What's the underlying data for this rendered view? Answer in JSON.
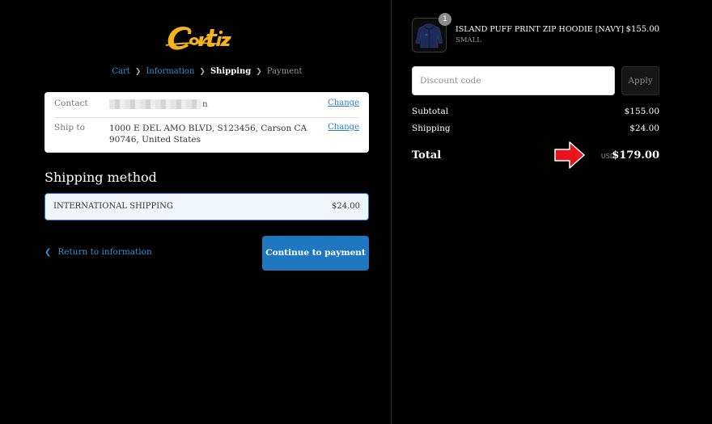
{
  "brand": {
    "logo_text": "Cortiz",
    "logo_color": "#f2b418"
  },
  "breadcrumb": [
    {
      "label": "Cart",
      "state": "link"
    },
    {
      "label": "Information",
      "state": "link"
    },
    {
      "label": "Shipping",
      "state": "current"
    },
    {
      "label": "Payment",
      "state": "upcoming"
    }
  ],
  "review": {
    "contact_label": "Contact",
    "contact_value_tail": "n",
    "ship_to_label": "Ship to",
    "ship_to_value": "1000 E DEL AMO BLVD, S123456, Carson CA 90746, United States",
    "change_label": "Change"
  },
  "shipping_method": {
    "title": "Shipping method",
    "option_name": "INTERNATIONAL SHIPPING",
    "option_price": "$24.00"
  },
  "actions": {
    "return_label": "Return to information",
    "continue_label": "Continue to payment"
  },
  "order": {
    "item": {
      "quantity": "1",
      "name": "ISLAND PUFF PRINT ZIP HOODIE [NAVY]",
      "variant": "SMALL",
      "price": "$155.00",
      "thumbnail_icon": "hoodie-icon"
    },
    "discount": {
      "placeholder": "Discount code",
      "apply_label": "Apply"
    },
    "subtotal_label": "Subtotal",
    "subtotal_value": "$155.00",
    "shipping_label": "Shipping",
    "shipping_value": "$24.00",
    "total_label": "Total",
    "currency": "USD",
    "total_value": "$179.00"
  },
  "colors": {
    "accent": "#1f77c0",
    "link": "#3a8fd0",
    "annotation_arrow": "#e8141c"
  }
}
